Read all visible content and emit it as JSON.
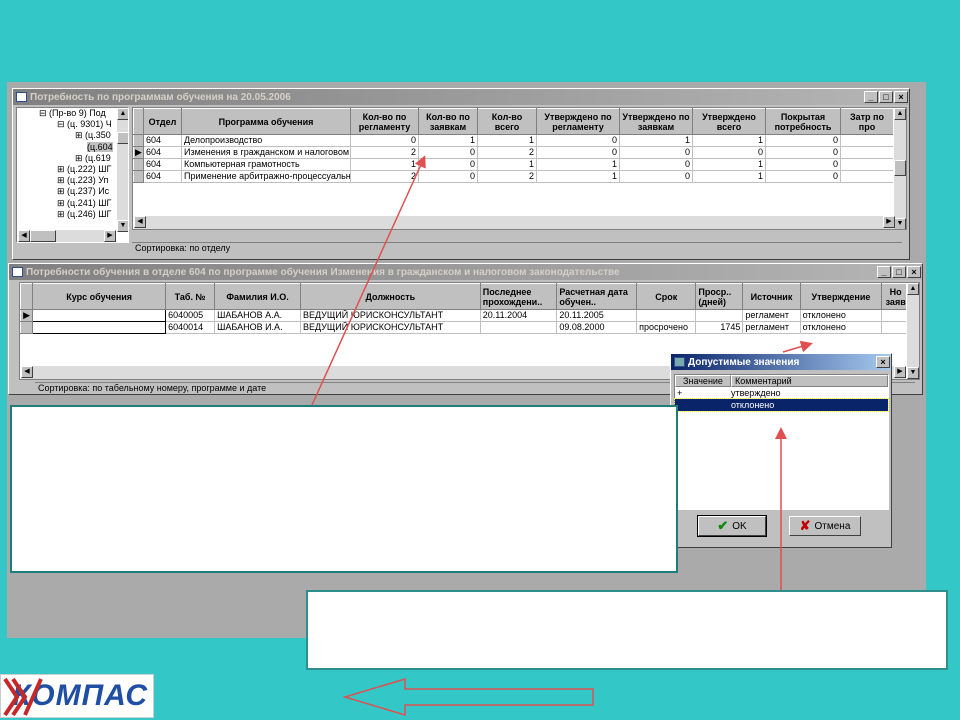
{
  "top_window": {
    "title": "Потребность по программам обучения на 20.05.2006",
    "tree": [
      "(Пр-во 9) Под",
      "(ц. 9301) Ч",
      "(ц.350",
      "(ц.604",
      "(ц.619",
      "(ц.222) ШГ",
      "(ц.223) Уп",
      "(ц.237) Ис",
      "(ц.241) ШГ",
      "(ц.246) ШГ"
    ],
    "columns": [
      "Отдел",
      "Программа обучения",
      "Кол-во по регламенту",
      "Кол-во по заявкам",
      "Кол-во всего",
      "Утверждено по регламенту",
      "Утверждено по заявкам",
      "Утверждено всего",
      "Покрытая потребность",
      "Затр по про"
    ],
    "rows": [
      [
        "604",
        "Делопроизводство",
        "0",
        "1",
        "1",
        "0",
        "1",
        "1",
        "0"
      ],
      [
        "604",
        "Изменения в гражданском и налоговом",
        "2",
        "0",
        "2",
        "0",
        "0",
        "0",
        "0"
      ],
      [
        "604",
        "Компьютерная грамотность",
        "1",
        "0",
        "1",
        "1",
        "0",
        "1",
        "0"
      ],
      [
        "604",
        "Применение арбитражно-процессуального",
        "2",
        "0",
        "2",
        "1",
        "0",
        "1",
        "0"
      ]
    ],
    "status": "Сортировка: по отделу"
  },
  "bottom_window": {
    "title": "Потребности обучения в отделе 604 по программе обучения Изменения в гражданском и налоговом законодательстве",
    "columns": [
      "Курс обучения",
      "Таб. №",
      "Фамилия И.О.",
      "Должность",
      "Последнее прохождени..",
      "Расчетная дата обучен..",
      "Срок",
      "Проср.. (дней)",
      "Источник",
      "Утверждение",
      "Но заяв"
    ],
    "rows": [
      [
        "",
        "6040005",
        "ШАБАНОВ А.А.",
        "ВЕДУЩИЙ ЮРИСКОНСУЛЬТАНТ",
        "20.11.2004",
        "20.11.2005",
        "",
        "",
        "регламент",
        "отклонено"
      ],
      [
        "",
        "6040014",
        "ШАБАНОВ И.А.",
        "ВЕДУЩИЙ ЮРИСКОНСУЛЬТАНТ",
        "",
        "09.08.2000",
        "просрочено",
        "1745",
        "регламент",
        "отклонено"
      ]
    ],
    "status": "Сортировка: по табельному номеру, программе и дате"
  },
  "dialog": {
    "title": "Допустимые значения",
    "columns": [
      "Значение",
      "Комментарий"
    ],
    "rows": [
      [
        "+",
        "утверждено"
      ],
      [
        "",
        "отклонено"
      ]
    ],
    "ok_label": "OK",
    "cancel_label": "Отмена"
  },
  "logo": {
    "text": "КОМПАС"
  },
  "colors": {
    "background": "#33c7c7",
    "arrow": "#e05050",
    "selection": "#0a246a"
  }
}
